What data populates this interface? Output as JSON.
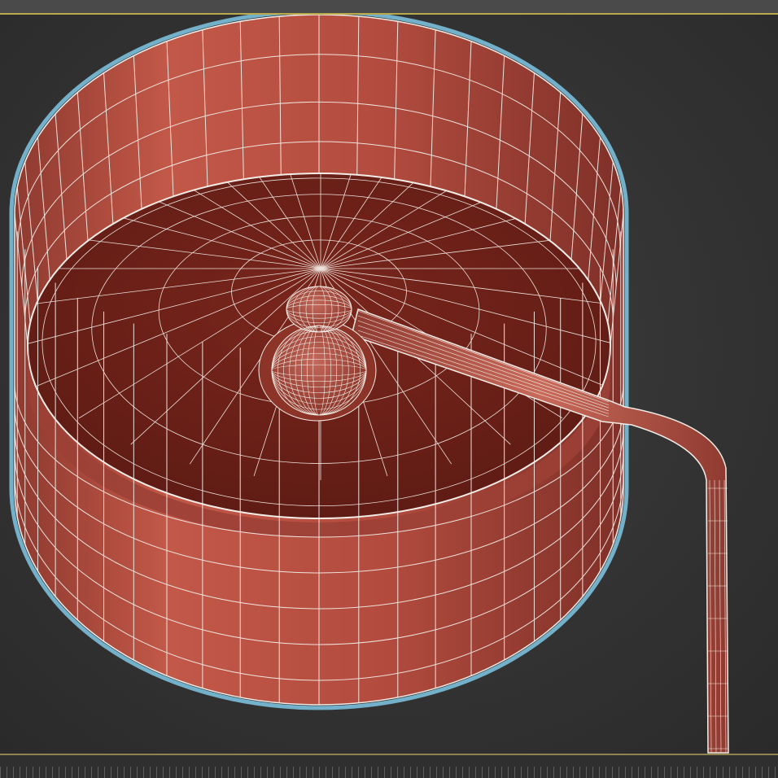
{
  "viewport": {
    "shading_mode": "wireframe-on-shaded",
    "object_color": "#b0493c",
    "interior_color": "#6e2219",
    "wire_color": "#f4ece6",
    "selection_outline_color": "#7fc8e6",
    "background_color": "#3a3a3a"
  },
  "timeline": {
    "accent_color": "#b9a94d"
  }
}
